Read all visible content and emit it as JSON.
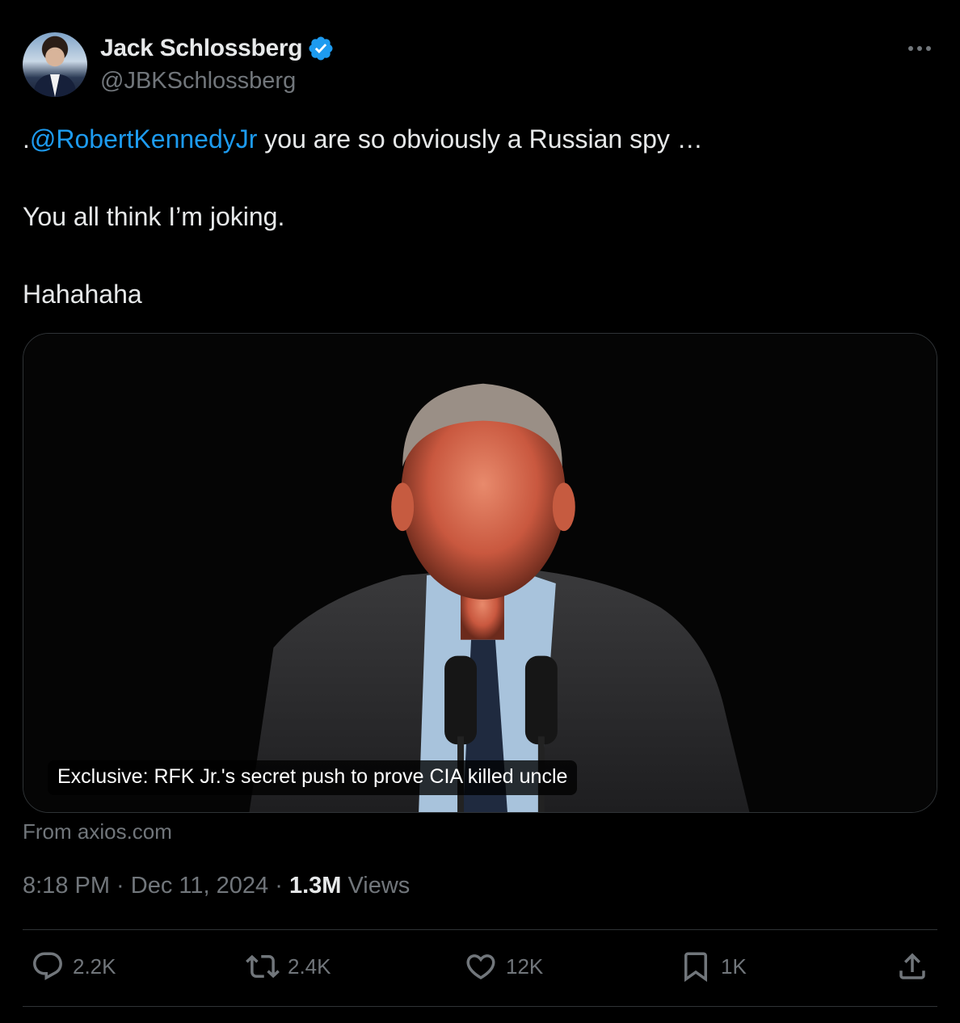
{
  "author": {
    "name": "Jack Schlossberg",
    "handle": "@JBKSchlossberg",
    "verified": true
  },
  "tweet": {
    "line1_prefix": ".",
    "mention": "@RobertKennedyJr",
    "line1_rest": " you are so obviously a Russian spy …",
    "line2": "You all think I’m joking.",
    "line3": "Hahahaha"
  },
  "link_card": {
    "headline": "Exclusive: RFK Jr.'s secret push to prove CIA killed uncle",
    "source": "From axios.com"
  },
  "meta": {
    "time": "8:18 PM",
    "separator": " · ",
    "date": "Dec 11, 2024",
    "views_count": "1.3M",
    "views_label": " Views"
  },
  "actions": {
    "replies": "2.2K",
    "reposts": "2.4K",
    "likes": "12K",
    "bookmarks": "1K"
  },
  "colors": {
    "background": "#000000",
    "text": "#e7e9ea",
    "muted": "#71767b",
    "link": "#1d9bf0",
    "verified": "#1d9bf0"
  }
}
